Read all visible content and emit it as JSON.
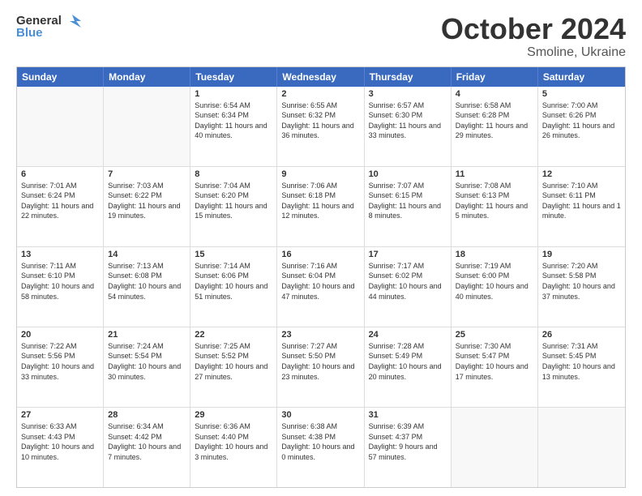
{
  "logo": {
    "text_general": "General",
    "text_blue": "Blue",
    "icon": "▶"
  },
  "title": {
    "month_year": "October 2024",
    "location": "Smoline, Ukraine"
  },
  "calendar": {
    "headers": [
      "Sunday",
      "Monday",
      "Tuesday",
      "Wednesday",
      "Thursday",
      "Friday",
      "Saturday"
    ],
    "rows": [
      [
        {
          "day": "",
          "info": "",
          "empty": true
        },
        {
          "day": "",
          "info": "",
          "empty": true
        },
        {
          "day": "1",
          "info": "Sunrise: 6:54 AM\nSunset: 6:34 PM\nDaylight: 11 hours and 40 minutes."
        },
        {
          "day": "2",
          "info": "Sunrise: 6:55 AM\nSunset: 6:32 PM\nDaylight: 11 hours and 36 minutes."
        },
        {
          "day": "3",
          "info": "Sunrise: 6:57 AM\nSunset: 6:30 PM\nDaylight: 11 hours and 33 minutes."
        },
        {
          "day": "4",
          "info": "Sunrise: 6:58 AM\nSunset: 6:28 PM\nDaylight: 11 hours and 29 minutes."
        },
        {
          "day": "5",
          "info": "Sunrise: 7:00 AM\nSunset: 6:26 PM\nDaylight: 11 hours and 26 minutes."
        }
      ],
      [
        {
          "day": "6",
          "info": "Sunrise: 7:01 AM\nSunset: 6:24 PM\nDaylight: 11 hours and 22 minutes."
        },
        {
          "day": "7",
          "info": "Sunrise: 7:03 AM\nSunset: 6:22 PM\nDaylight: 11 hours and 19 minutes."
        },
        {
          "day": "8",
          "info": "Sunrise: 7:04 AM\nSunset: 6:20 PM\nDaylight: 11 hours and 15 minutes."
        },
        {
          "day": "9",
          "info": "Sunrise: 7:06 AM\nSunset: 6:18 PM\nDaylight: 11 hours and 12 minutes."
        },
        {
          "day": "10",
          "info": "Sunrise: 7:07 AM\nSunset: 6:15 PM\nDaylight: 11 hours and 8 minutes."
        },
        {
          "day": "11",
          "info": "Sunrise: 7:08 AM\nSunset: 6:13 PM\nDaylight: 11 hours and 5 minutes."
        },
        {
          "day": "12",
          "info": "Sunrise: 7:10 AM\nSunset: 6:11 PM\nDaylight: 11 hours and 1 minute."
        }
      ],
      [
        {
          "day": "13",
          "info": "Sunrise: 7:11 AM\nSunset: 6:10 PM\nDaylight: 10 hours and 58 minutes."
        },
        {
          "day": "14",
          "info": "Sunrise: 7:13 AM\nSunset: 6:08 PM\nDaylight: 10 hours and 54 minutes."
        },
        {
          "day": "15",
          "info": "Sunrise: 7:14 AM\nSunset: 6:06 PM\nDaylight: 10 hours and 51 minutes."
        },
        {
          "day": "16",
          "info": "Sunrise: 7:16 AM\nSunset: 6:04 PM\nDaylight: 10 hours and 47 minutes."
        },
        {
          "day": "17",
          "info": "Sunrise: 7:17 AM\nSunset: 6:02 PM\nDaylight: 10 hours and 44 minutes."
        },
        {
          "day": "18",
          "info": "Sunrise: 7:19 AM\nSunset: 6:00 PM\nDaylight: 10 hours and 40 minutes."
        },
        {
          "day": "19",
          "info": "Sunrise: 7:20 AM\nSunset: 5:58 PM\nDaylight: 10 hours and 37 minutes."
        }
      ],
      [
        {
          "day": "20",
          "info": "Sunrise: 7:22 AM\nSunset: 5:56 PM\nDaylight: 10 hours and 33 minutes."
        },
        {
          "day": "21",
          "info": "Sunrise: 7:24 AM\nSunset: 5:54 PM\nDaylight: 10 hours and 30 minutes."
        },
        {
          "day": "22",
          "info": "Sunrise: 7:25 AM\nSunset: 5:52 PM\nDaylight: 10 hours and 27 minutes."
        },
        {
          "day": "23",
          "info": "Sunrise: 7:27 AM\nSunset: 5:50 PM\nDaylight: 10 hours and 23 minutes."
        },
        {
          "day": "24",
          "info": "Sunrise: 7:28 AM\nSunset: 5:49 PM\nDaylight: 10 hours and 20 minutes."
        },
        {
          "day": "25",
          "info": "Sunrise: 7:30 AM\nSunset: 5:47 PM\nDaylight: 10 hours and 17 minutes."
        },
        {
          "day": "26",
          "info": "Sunrise: 7:31 AM\nSunset: 5:45 PM\nDaylight: 10 hours and 13 minutes."
        }
      ],
      [
        {
          "day": "27",
          "info": "Sunrise: 6:33 AM\nSunset: 4:43 PM\nDaylight: 10 hours and 10 minutes."
        },
        {
          "day": "28",
          "info": "Sunrise: 6:34 AM\nSunset: 4:42 PM\nDaylight: 10 hours and 7 minutes."
        },
        {
          "day": "29",
          "info": "Sunrise: 6:36 AM\nSunset: 4:40 PM\nDaylight: 10 hours and 3 minutes."
        },
        {
          "day": "30",
          "info": "Sunrise: 6:38 AM\nSunset: 4:38 PM\nDaylight: 10 hours and 0 minutes."
        },
        {
          "day": "31",
          "info": "Sunrise: 6:39 AM\nSunset: 4:37 PM\nDaylight: 9 hours and 57 minutes."
        },
        {
          "day": "",
          "info": "",
          "empty": true
        },
        {
          "day": "",
          "info": "",
          "empty": true
        }
      ]
    ]
  }
}
